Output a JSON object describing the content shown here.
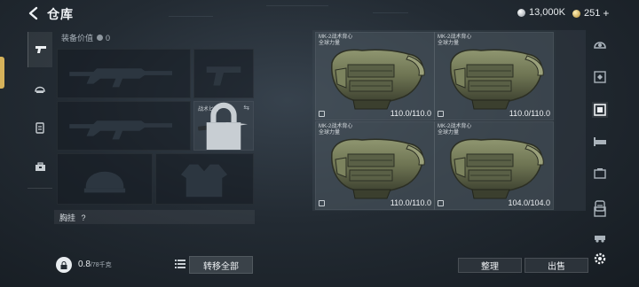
{
  "header": {
    "title": "仓库",
    "currency_silver": "13,000K",
    "currency_gold": "251"
  },
  "left_rail": {
    "items": [
      {
        "icon": "pistol-icon",
        "active": true
      },
      {
        "icon": "helmet-icon",
        "active": false
      },
      {
        "icon": "vest-icon",
        "active": false
      },
      {
        "icon": "toolbox-icon",
        "active": false
      }
    ]
  },
  "equipment": {
    "value_label": "装备价值",
    "value": "0",
    "knife_label": "战术匕首",
    "chest_label": "胸挂",
    "chest_help": "?",
    "capacity_value": "0.8",
    "capacity_unit": "/78千克",
    "transfer_all_label": "转移全部"
  },
  "storage": {
    "items": [
      {
        "name_line1": "MK-2战术背心",
        "name_line2": "全球力量",
        "durability": "110.0/110.0"
      },
      {
        "name_line1": "MK-2战术背心",
        "name_line2": "全球力量",
        "durability": "110.0/110.0"
      },
      {
        "name_line1": "MK-2战术背心",
        "name_line2": "全球力量",
        "durability": "110.0/110.0"
      },
      {
        "name_line1": "MK-2战术背心",
        "name_line2": "全球力量",
        "durability": "104.0/104.0"
      }
    ],
    "sort_label": "整理",
    "sell_label": "出售"
  },
  "right_rail": {
    "icons": [
      "helmet-filter-icon",
      "armor-filter-icon",
      "vest-filter-icon",
      "bed-filter-icon",
      "case-filter-icon",
      "backpack-filter-icon",
      "box-filter-icon",
      "car-filter-icon",
      "settings-icon"
    ],
    "active_index": 2
  },
  "colors": {
    "accent": "#d6b25a",
    "panel": "#232b33",
    "text": "#d6dbe0"
  }
}
